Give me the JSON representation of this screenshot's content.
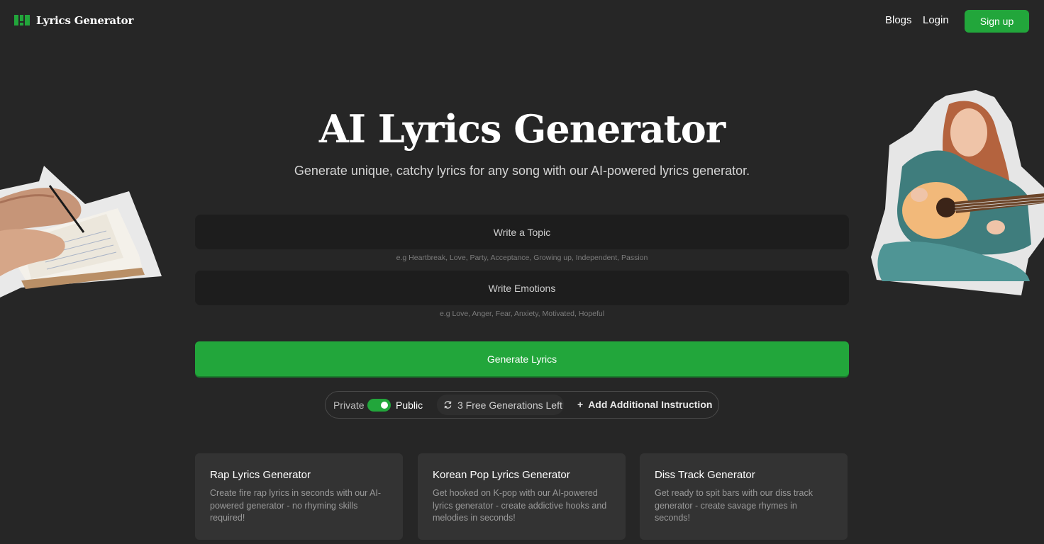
{
  "header": {
    "brand": "Lyrics Generator",
    "nav": {
      "blogs": "Blogs",
      "login": "Login",
      "signup": "Sign up"
    }
  },
  "hero": {
    "title": "AI Lyrics Generator",
    "subtitle": "Generate unique, catchy lyrics for any song with our AI-powered lyrics generator."
  },
  "form": {
    "topic": {
      "placeholder": "Write a Topic",
      "value": "",
      "hint": "e.g Heartbreak, Love, Party, Acceptance, Growing up, Independent, Passion"
    },
    "emotions": {
      "placeholder": "Write Emotions",
      "value": "",
      "hint": "e.g Love, Anger, Fear, Anxiety, Motivated, Hopeful"
    },
    "generate_label": "Generate Lyrics"
  },
  "options": {
    "private_label": "Private",
    "public_label": "Public",
    "visibility": "Public",
    "credits_label": "3 Free Generations Left",
    "add_instruction_label": "Add Additional Instruction"
  },
  "cards": [
    {
      "title": "Rap Lyrics Generator",
      "description": "Create fire rap lyrics in seconds with our AI-powered generator - no rhyming skills required!"
    },
    {
      "title": "Korean Pop Lyrics Generator",
      "description": "Get hooked on K-pop with our AI-powered lyrics generator - create addictive hooks and melodies in seconds!"
    },
    {
      "title": "Diss Track Generator",
      "description": "Get ready to spit bars with our diss track generator - create savage rhymes in seconds!"
    }
  ],
  "icons": {
    "logo": "logo-icon",
    "refresh": "refresh-icon",
    "plus": "plus-icon"
  },
  "colors": {
    "background": "#262626",
    "accent": "#22a63b",
    "field": "#1d1d1d",
    "card": "#333333"
  }
}
